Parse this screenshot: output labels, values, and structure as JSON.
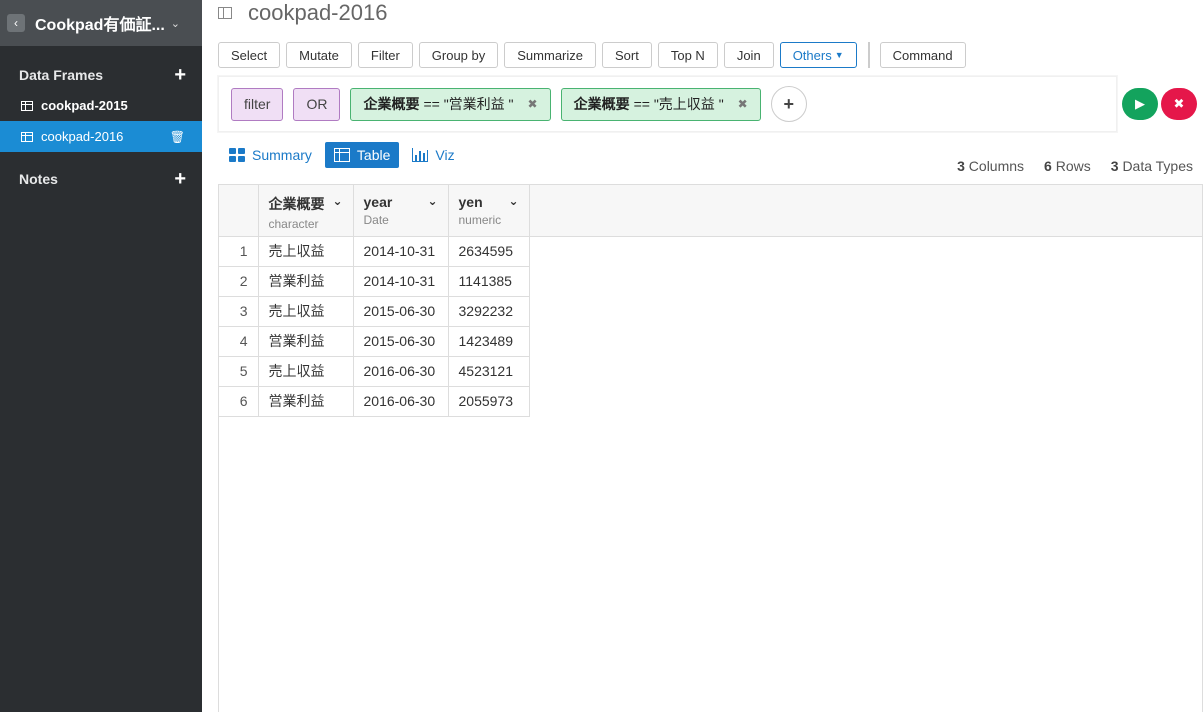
{
  "sidebar": {
    "project_title": "Cookpad有価証...",
    "data_frames_label": "Data Frames",
    "items": [
      {
        "label": "cookpad-2015"
      },
      {
        "label": "cookpad-2016"
      }
    ],
    "notes_label": "Notes"
  },
  "page": {
    "title": "cookpad-2016"
  },
  "toolbar": {
    "buttons": [
      "Select",
      "Mutate",
      "Filter",
      "Group by",
      "Summarize",
      "Sort",
      "Top N",
      "Join"
    ],
    "others": "Others",
    "command": "Command"
  },
  "filter": {
    "verb": "filter",
    "op": "OR",
    "conditions": [
      {
        "field": "企業概要",
        "expr": "== \"営業利益 \""
      },
      {
        "field": "企業概要",
        "expr": "== \"売上収益 \""
      }
    ]
  },
  "views": {
    "summary": "Summary",
    "table": "Table",
    "viz": "Viz"
  },
  "stats": {
    "columns_count": "3",
    "columns_label": "Columns",
    "rows_count": "6",
    "rows_label": "Rows",
    "types_count": "3",
    "types_label": "Data Types"
  },
  "table": {
    "columns": [
      {
        "name": "企業概要",
        "type": "character"
      },
      {
        "name": "year",
        "type": "Date"
      },
      {
        "name": "yen",
        "type": "numeric"
      }
    ],
    "rows": [
      [
        "1",
        "売上収益",
        "2014-10-31",
        "2634595"
      ],
      [
        "2",
        "営業利益",
        "2014-10-31",
        "1141385"
      ],
      [
        "3",
        "売上収益",
        "2015-06-30",
        "3292232"
      ],
      [
        "4",
        "営業利益",
        "2015-06-30",
        "1423489"
      ],
      [
        "5",
        "売上収益",
        "2016-06-30",
        "4523121"
      ],
      [
        "6",
        "営業利益",
        "2016-06-30",
        "2055973"
      ]
    ]
  },
  "colors": {
    "sidebar_bg": "#2b2e31",
    "active_item": "#1b8cd4",
    "accent_blue": "#1b7ac8",
    "run_green": "#13a35d",
    "cancel_red": "#e5174a"
  }
}
